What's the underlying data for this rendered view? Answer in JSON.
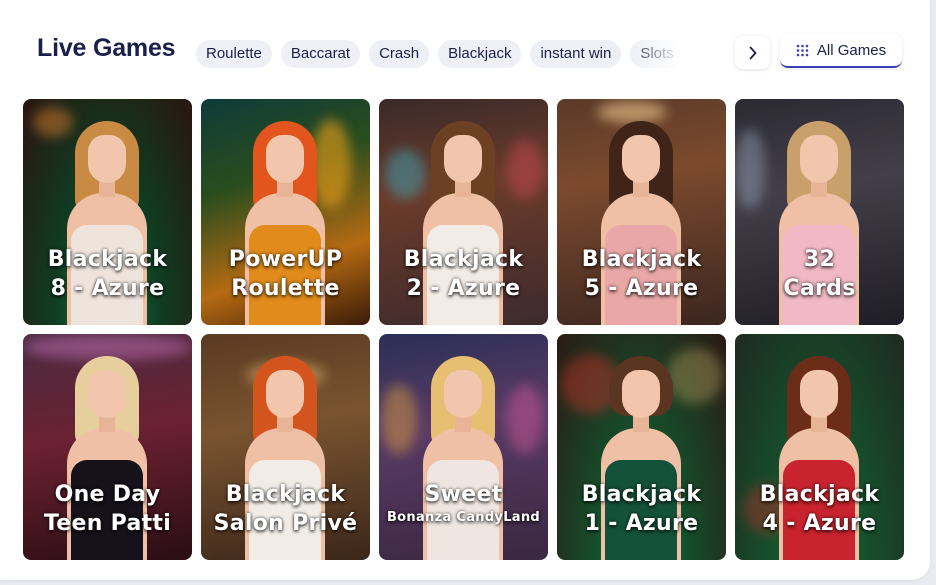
{
  "section": {
    "title": "Live Games"
  },
  "categories": [
    "Roulette",
    "Baccarat",
    "Crash",
    "Blackjack",
    "instant win",
    "Slots"
  ],
  "nav": {
    "all_games_label": "All Games",
    "arrow_icon": "chevron-right-icon",
    "grid_icon": "grid-dots-icon"
  },
  "colors": {
    "title": "#1b1f4b",
    "accent": "#3b3fb5",
    "chip_bg": "#eef0f5"
  },
  "games": [
    {
      "line1": "Blackjack",
      "line2": "8 - Azure"
    },
    {
      "line1": "PowerUP",
      "line2": "Roulette"
    },
    {
      "line1": "Blackjack",
      "line2": "2 - Azure"
    },
    {
      "line1": "Blackjack",
      "line2": "5 - Azure"
    },
    {
      "line1": "32",
      "line2": "Cards"
    },
    {
      "line1": "One Day",
      "line2": "Teen Patti"
    },
    {
      "line1": "Blackjack",
      "line2": "Salon Privé"
    },
    {
      "line1": "Sweet",
      "line2": "Bonanza CandyLand"
    },
    {
      "line1": "Blackjack",
      "line2": "1 - Azure"
    },
    {
      "line1": "Blackjack",
      "line2": "4 - Azure"
    }
  ]
}
